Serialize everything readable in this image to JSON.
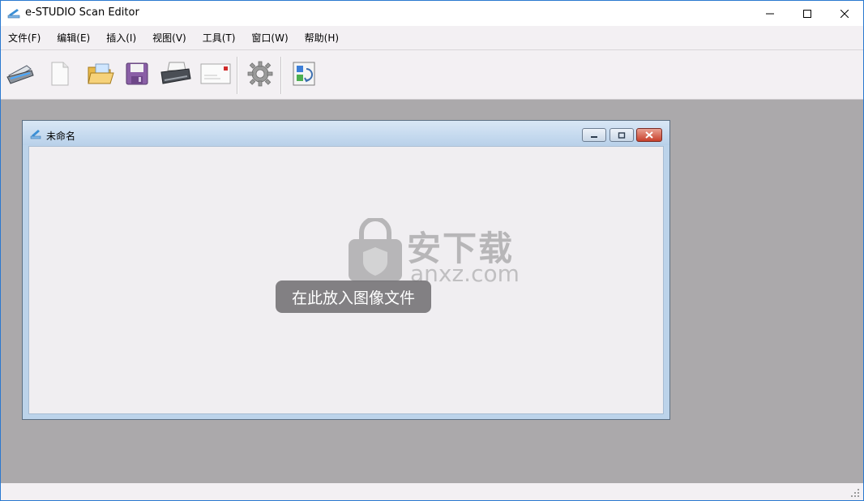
{
  "window": {
    "title": "e-STUDIO Scan Editor",
    "controls": {
      "minimize": "minimize",
      "maximize": "maximize",
      "close": "close"
    }
  },
  "menu": [
    {
      "label": "文件(F)"
    },
    {
      "label": "编辑(E)"
    },
    {
      "label": "插入(I)"
    },
    {
      "label": "视图(V)"
    },
    {
      "label": "工具(T)"
    },
    {
      "label": "窗口(W)"
    },
    {
      "label": "帮助(H)"
    }
  ],
  "toolbar": [
    {
      "icon": "scanner-icon"
    },
    {
      "icon": "new-document-icon"
    },
    {
      "icon": "open-folder-icon"
    },
    {
      "icon": "save-icon"
    },
    {
      "icon": "print-icon"
    },
    {
      "icon": "email-icon"
    },
    {
      "icon": "settings-icon"
    },
    {
      "icon": "convert-icon"
    }
  ],
  "document_window": {
    "title": "未命名",
    "drop_hint": "在此放入图像文件"
  },
  "watermark": {
    "text_cn": "安下载",
    "text_en": "anxz.com"
  },
  "colors": {
    "workspace": "#aba9ab",
    "toolbar_bg": "#f3f0f3",
    "child_frame": "#bcd3ea",
    "close_red": "#c8402c"
  }
}
